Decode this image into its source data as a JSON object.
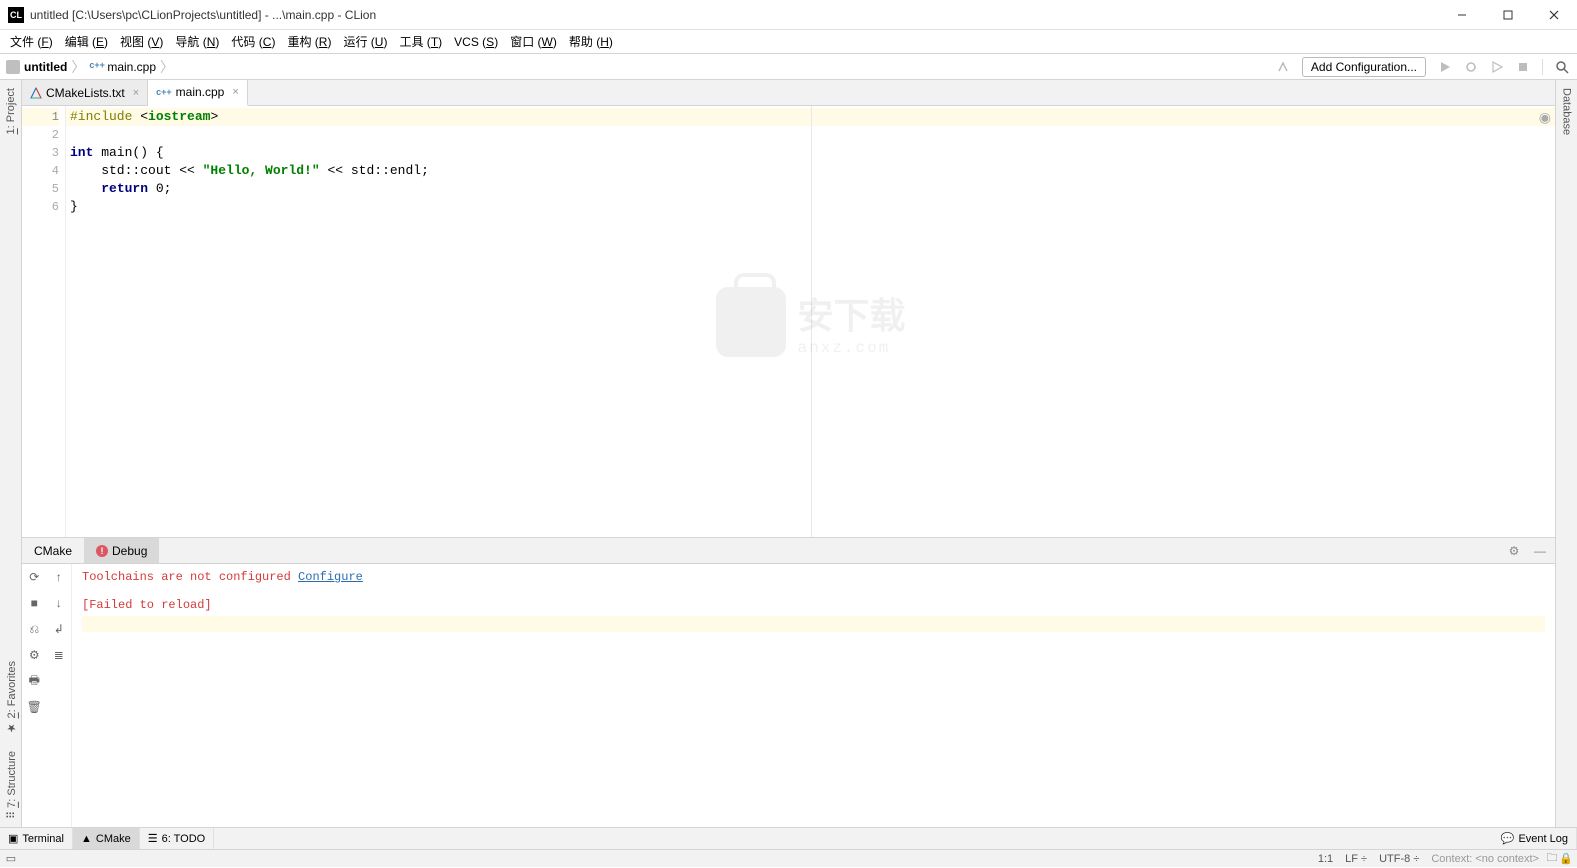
{
  "title": "untitled [C:\\Users\\pc\\CLionProjects\\untitled] - ...\\main.cpp - CLion",
  "menu": {
    "items": [
      {
        "label": "文件",
        "mn": "F"
      },
      {
        "label": "编辑",
        "mn": "E"
      },
      {
        "label": "视图",
        "mn": "V"
      },
      {
        "label": "导航",
        "mn": "N"
      },
      {
        "label": "代码",
        "mn": "C"
      },
      {
        "label": "重构",
        "mn": "R"
      },
      {
        "label": "运行",
        "mn": "U"
      },
      {
        "label": "工具",
        "mn": "T"
      },
      {
        "label": "VCS",
        "mn": "S"
      },
      {
        "label": "窗口",
        "mn": "W"
      },
      {
        "label": "帮助",
        "mn": "H"
      }
    ]
  },
  "breadcrumbs": {
    "items": [
      {
        "icon": "folder",
        "label": "untitled",
        "bold": true
      },
      {
        "icon": "cpp",
        "label": "main.cpp",
        "bold": false
      }
    ]
  },
  "run_config": {
    "label": "Add Configuration..."
  },
  "editor_tabs": {
    "items": [
      {
        "icon": "cmake",
        "label": "CMakeLists.txt",
        "active": false
      },
      {
        "icon": "cpp",
        "label": "main.cpp",
        "active": true
      }
    ]
  },
  "sidebar_left": {
    "items": [
      {
        "label": "1: Project",
        "num": "1"
      },
      {
        "label": "2: Favorites",
        "num": "2"
      },
      {
        "label": "7: Structure",
        "num": "7"
      }
    ]
  },
  "sidebar_right": {
    "label": "Database"
  },
  "code": {
    "lines": [
      {
        "n": "1",
        "html": "<span class='pp'>#include</span> &lt;<span class='inc-name'>iostream</span>&gt;",
        "current": true
      },
      {
        "n": "2",
        "html": ""
      },
      {
        "n": "3",
        "html": "<span class='kw'>int</span> main() {"
      },
      {
        "n": "4",
        "html": "    std::cout &lt;&lt; <span class='str'>\"Hello, World!\"</span> &lt;&lt; std::endl;"
      },
      {
        "n": "5",
        "html": "    <span class='kw'>return</span> 0;"
      },
      {
        "n": "6",
        "html": "}"
      }
    ]
  },
  "watermark": {
    "main": "安下载",
    "sub": "anxz.com"
  },
  "bottom_panel": {
    "tabs": [
      {
        "label": "CMake",
        "active": false,
        "err": false
      },
      {
        "label": "Debug",
        "active": true,
        "err": true
      }
    ],
    "output": {
      "line1_prefix": "Toolchains are not configured ",
      "line1_link": "Configure",
      "line2": "[Failed to reload]"
    }
  },
  "bottom_toolbar": {
    "items": [
      {
        "icon": "terminal",
        "label": "Terminal",
        "active": false
      },
      {
        "icon": "cmake",
        "label": "CMake",
        "active": true
      },
      {
        "icon": "todo",
        "label": "6: TODO",
        "active": false
      }
    ],
    "eventlog": "Event Log"
  },
  "statusbar": {
    "pos": "1:1",
    "sep": "LF",
    "enc": "UTF-8",
    "context": "Context: <no context>"
  }
}
